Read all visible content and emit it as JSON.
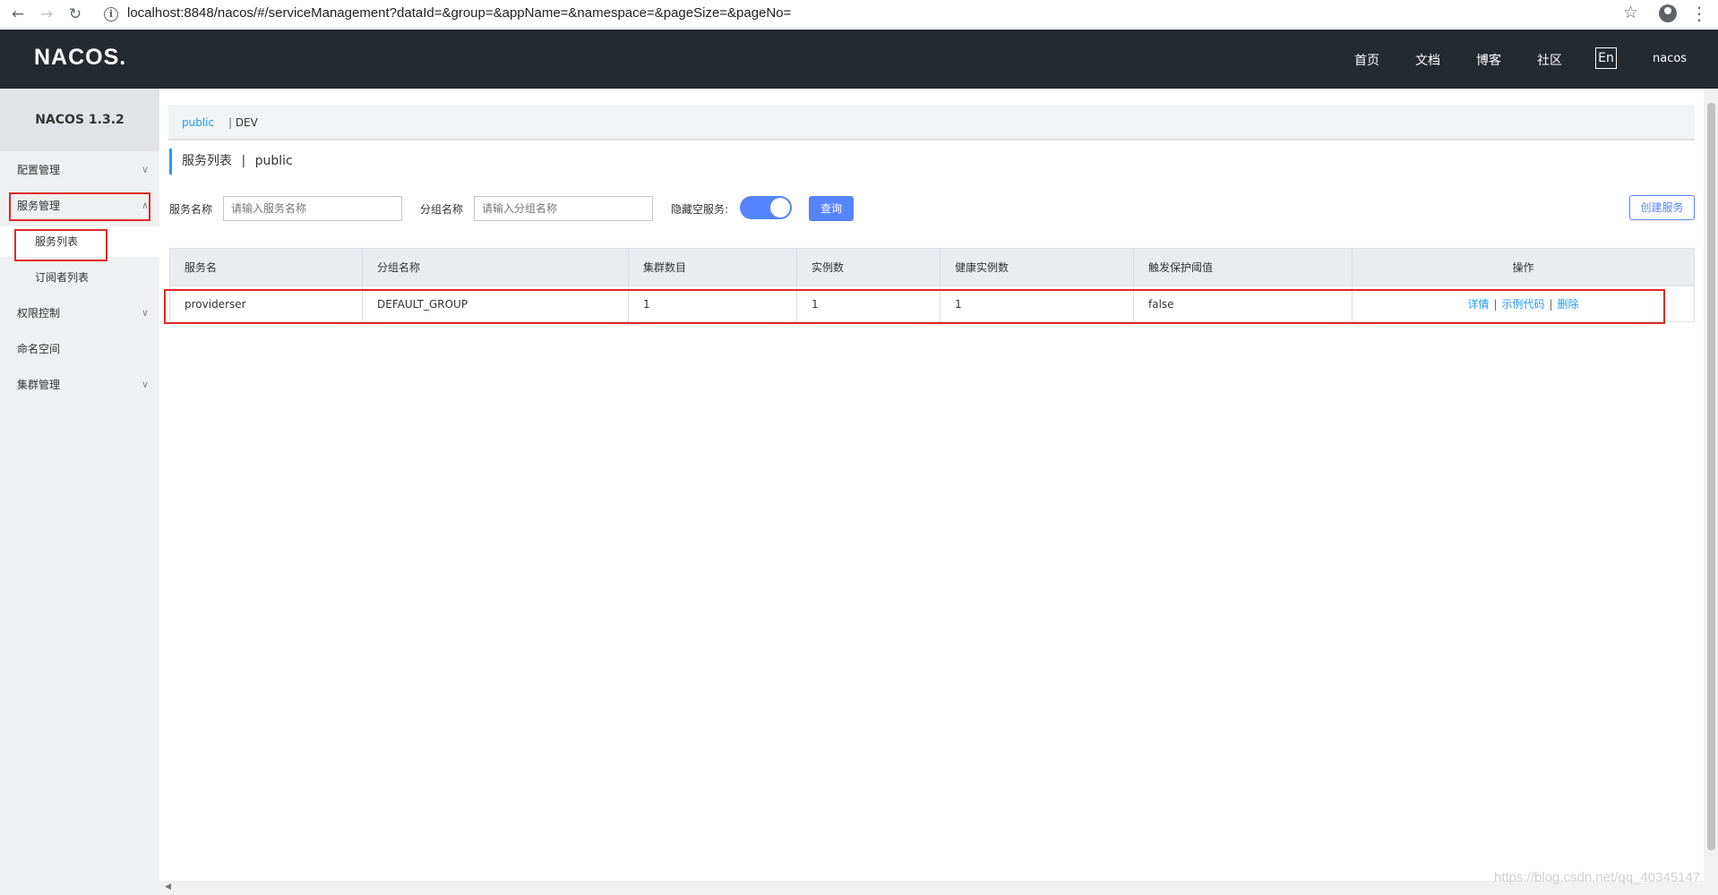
{
  "browser": {
    "url": "localhost:8848/nacos/#/serviceManagement?dataId=&group=&appName=&namespace=&pageSize=&pageNo="
  },
  "header": {
    "logo": "NACOS.",
    "nav": [
      "首页",
      "文档",
      "博客",
      "社区"
    ],
    "lang": "En",
    "user": "nacos"
  },
  "sidebar": {
    "version": "NACOS 1.3.2",
    "items": [
      {
        "label": "配置管理"
      },
      {
        "label": "服务管理"
      },
      {
        "label": "服务列表"
      },
      {
        "label": "订阅者列表"
      },
      {
        "label": "权限控制"
      },
      {
        "label": "命名空间"
      },
      {
        "label": "集群管理"
      }
    ]
  },
  "namespaces": {
    "active": "public",
    "other": "DEV",
    "separator": "|"
  },
  "page": {
    "title": "服务列表",
    "title_sep": "|",
    "title_ns": "public"
  },
  "filters": {
    "service_name_label": "服务名称",
    "service_name_placeholder": "请输入服务名称",
    "group_name_label": "分组名称",
    "group_name_placeholder": "请输入分组名称",
    "hide_empty_label": "隐藏空服务:",
    "hide_empty_on": true,
    "query_button": "查询",
    "create_button": "创建服务"
  },
  "table": {
    "headers": [
      "服务名",
      "分组名称",
      "集群数目",
      "实例数",
      "健康实例数",
      "触发保护阈值",
      "操作"
    ],
    "rows": [
      {
        "service": "providerser",
        "group": "DEFAULT_GROUP",
        "clusters": "1",
        "instances": "1",
        "healthy": "1",
        "threshold": "false",
        "ops": [
          "详情",
          "示例代码",
          "删除"
        ]
      }
    ],
    "op_separator": "|"
  },
  "watermark": "https://blog.csdn.net/qq_40345147",
  "colors": {
    "header_bg": "#252a2f",
    "sidebar_bg": "#eef0f2",
    "accent": "#209bfa",
    "primary": "#5584ff",
    "highlight": "#e02828"
  }
}
